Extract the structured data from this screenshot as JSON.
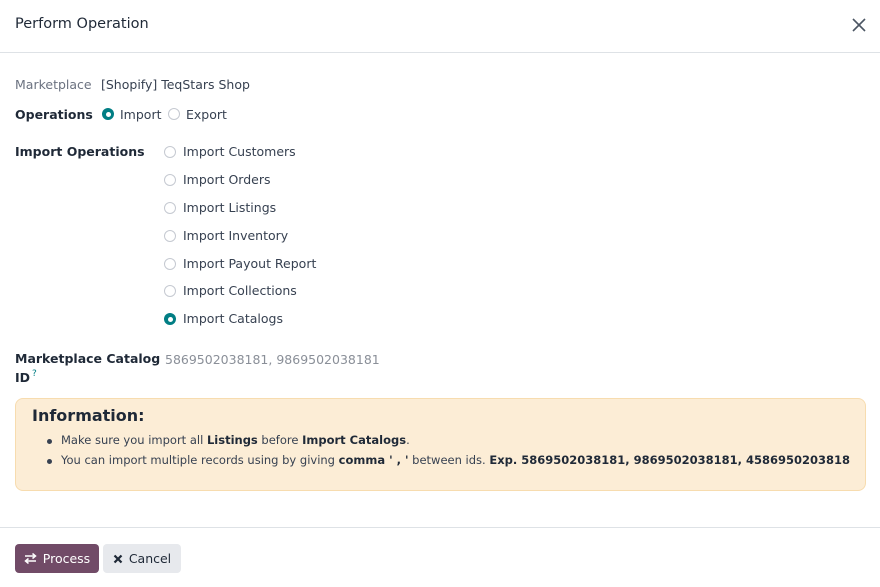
{
  "dialog": {
    "title": "Perform Operation"
  },
  "form": {
    "marketplace_label": "Marketplace",
    "marketplace_value": "[Shopify] TeqStars Shop",
    "operations_label": "Operations",
    "operations": [
      {
        "label": "Import",
        "checked": true
      },
      {
        "label": "Export",
        "checked": false
      }
    ],
    "import_operations_label": "Import Operations",
    "import_operations": [
      {
        "label": "Import Customers",
        "checked": false
      },
      {
        "label": "Import Orders",
        "checked": false
      },
      {
        "label": "Import Listings",
        "checked": false
      },
      {
        "label": "Import Inventory",
        "checked": false
      },
      {
        "label": "Import Payout Report",
        "checked": false
      },
      {
        "label": "Import Collections",
        "checked": false
      },
      {
        "label": "Import Catalogs",
        "checked": true
      }
    ],
    "catalog_label_line1": "Marketplace Catalog",
    "catalog_label_line2": "ID",
    "catalog_help": "?",
    "catalog_value": "5869502038181, 9869502038181"
  },
  "info": {
    "title": "Information:",
    "line1": {
      "p1": "Make sure you import all ",
      "b1": "Listings",
      "p2": " before ",
      "b2": "Import Catalogs",
      "p3": "."
    },
    "line2": {
      "p1": "You can import multiple records using by giving ",
      "b1": "comma ' , '",
      "p2": " between ids. ",
      "b2": "Exp. 5869502038181, 9869502038181, 4586950203818"
    }
  },
  "footer": {
    "process_label": "Process",
    "cancel_label": "Cancel"
  },
  "colors": {
    "primary": "#714b67",
    "accent": "#017e84",
    "info_bg": "#fcedd6"
  },
  "icons": {
    "close": "close-icon",
    "process": "exchange-icon",
    "cancel": "times-icon"
  }
}
